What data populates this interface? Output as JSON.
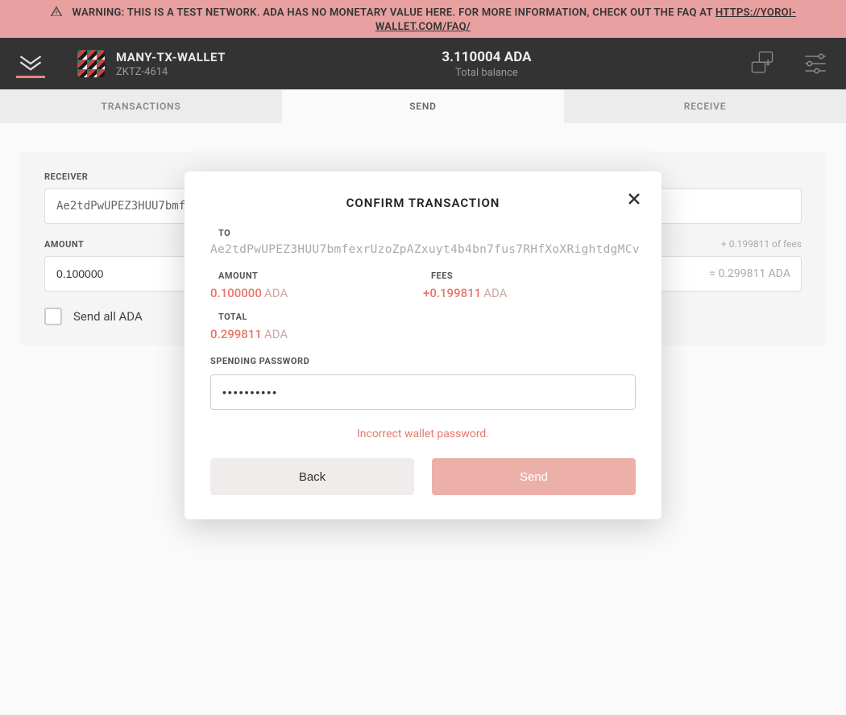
{
  "warning": {
    "text": "WARNING: THIS IS A TEST NETWORK. ADA HAS NO MONETARY VALUE HERE. FOR MORE INFORMATION, CHECK OUT THE FAQ AT ",
    "link": "HTTPS://YOROI-WALLET.COM/FAQ/"
  },
  "header": {
    "wallet_name": "MANY-TX-WALLET",
    "wallet_id": "ZKTZ-4614",
    "balance": "3.110004 ADA",
    "balance_label": "Total balance"
  },
  "tabs": {
    "transactions": "TRANSACTIONS",
    "send": "SEND",
    "receive": "RECEIVE"
  },
  "form": {
    "receiver_label": "RECEIVER",
    "receiver_value": "Ae2tdPwUPEZ3HUU7bmfe",
    "amount_label": "AMOUNT",
    "amount_value": "0.100000",
    "fees_hint": "+ 0.199811 of fees",
    "total_hint": "= 0.299811 ADA",
    "sendall_label": "Send all ADA"
  },
  "modal": {
    "title": "CONFIRM TRANSACTION",
    "to_label": "TO",
    "to_value": "Ae2tdPwUPEZ3HUU7bmfexrUzoZpAZxuyt4b4bn7fus7RHfXoXRightdgMCv",
    "amount_label": "AMOUNT",
    "amount_value": "0.100000",
    "amount_unit": "ADA",
    "fees_label": "FEES",
    "fees_value": "+0.199811",
    "fees_unit": "ADA",
    "total_label": "TOTAL",
    "total_value": "0.299811",
    "total_unit": "ADA",
    "pw_label": "SPENDING PASSWORD",
    "pw_value": "••••••••••",
    "error": "Incorrect wallet password.",
    "back": "Back",
    "send": "Send"
  }
}
